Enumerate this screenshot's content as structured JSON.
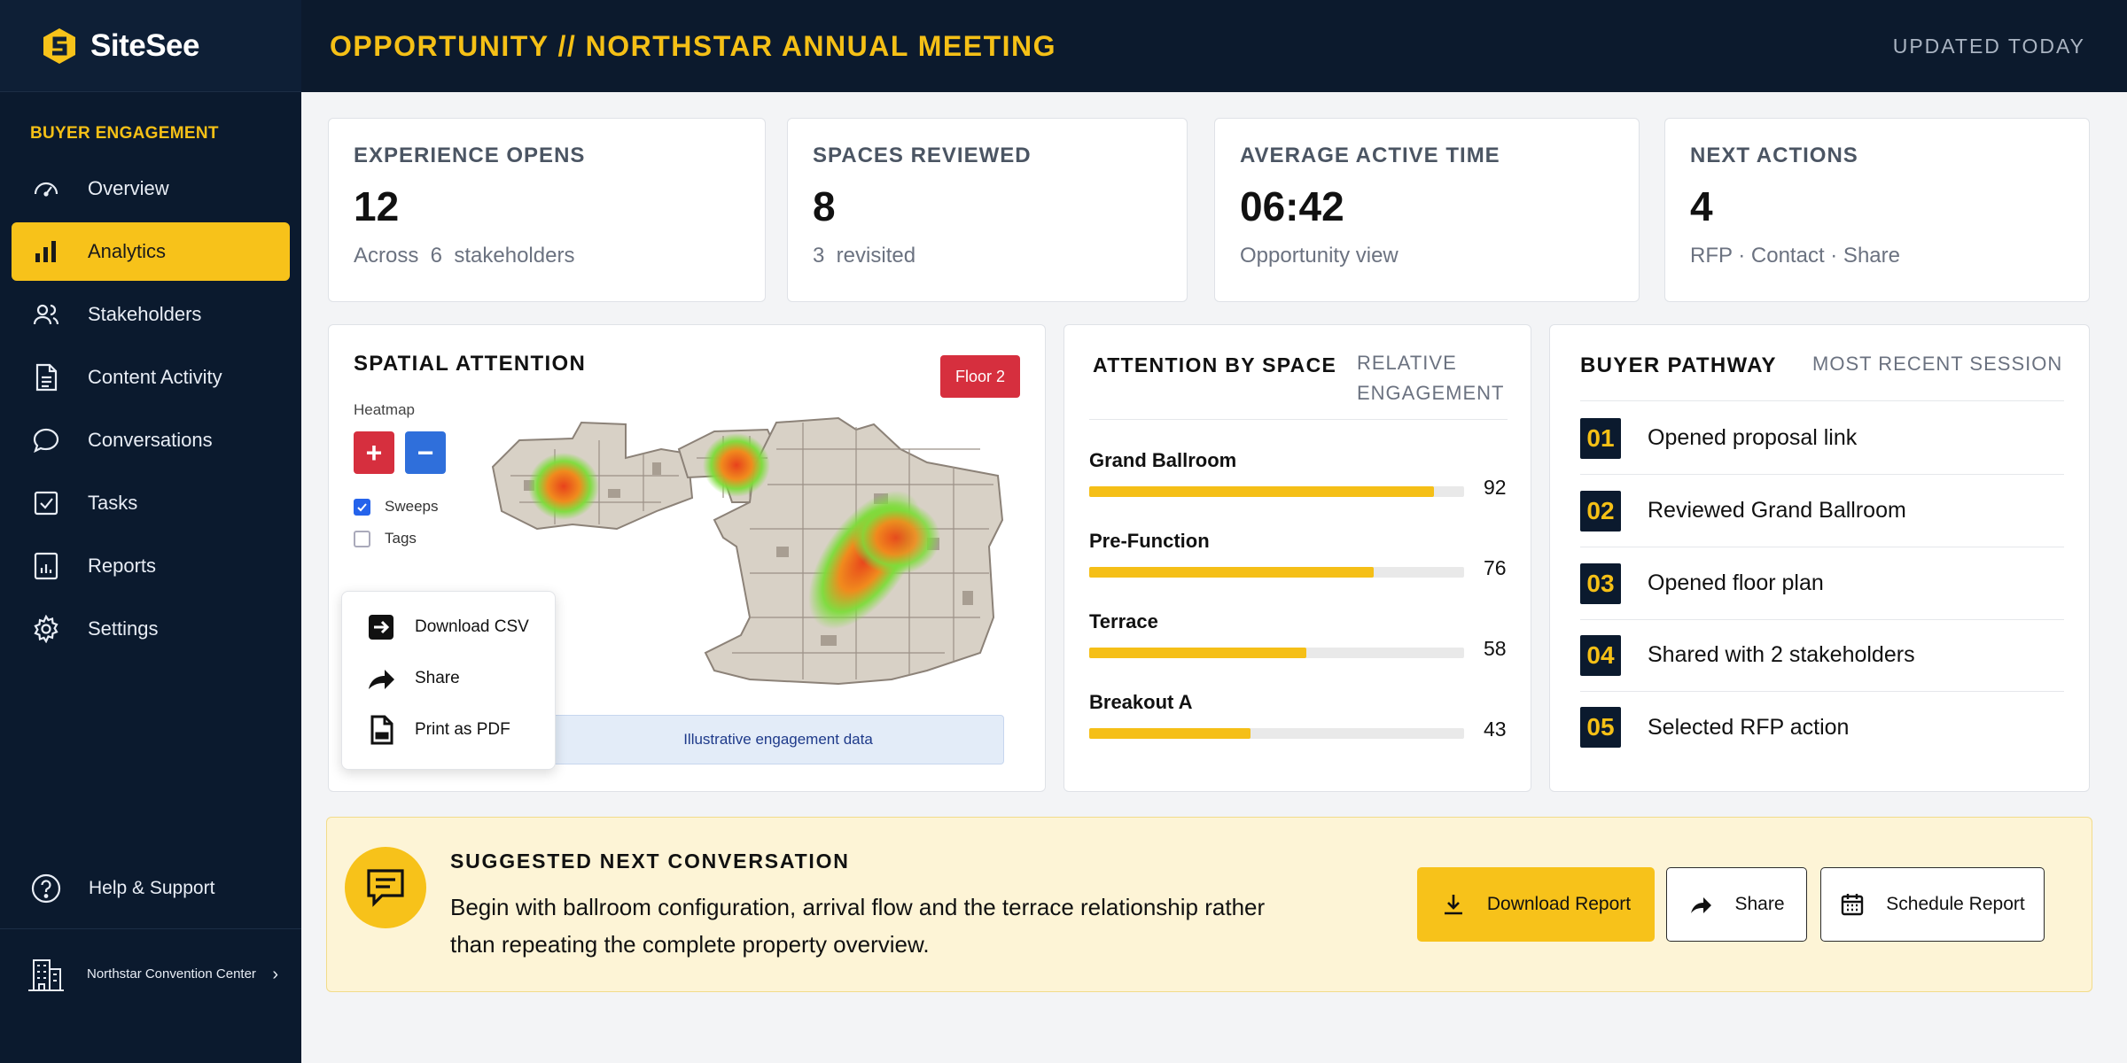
{
  "app": {
    "name": "SiteSee"
  },
  "sidebar": {
    "section_label": "BUYER ENGAGEMENT",
    "items": [
      {
        "label": "Overview",
        "icon": "gauge-icon"
      },
      {
        "label": "Analytics",
        "icon": "bar-chart-icon",
        "active": true
      },
      {
        "label": "Stakeholders",
        "icon": "users-icon"
      },
      {
        "label": "Content Activity",
        "icon": "document-icon"
      },
      {
        "label": "Conversations",
        "icon": "chat-icon"
      },
      {
        "label": "Tasks",
        "icon": "checkbox-icon"
      },
      {
        "label": "Reports",
        "icon": "report-icon"
      },
      {
        "label": "Settings",
        "icon": "gear-icon"
      }
    ],
    "help_label": "Help & Support",
    "venue_label": "Northstar Convention Center"
  },
  "header": {
    "title": "OPPORTUNITY // NORTHSTAR ANNUAL MEETING",
    "updated": "UPDATED TODAY"
  },
  "stats": [
    {
      "label": "EXPERIENCE OPENS",
      "value": "12",
      "sub": "Across  6  stakeholders"
    },
    {
      "label": "SPACES REVIEWED",
      "value": "8",
      "sub": "3  revisited"
    },
    {
      "label": "AVERAGE ACTIVE TIME",
      "value": "06:42",
      "sub": "Opportunity view"
    },
    {
      "label": "NEXT ACTIONS",
      "value": "4",
      "sub": "RFP · Contact · Share"
    }
  ],
  "spatial": {
    "title": "SPATIAL ATTENTION",
    "floor": "Floor 2",
    "heatmap_label": "Heatmap",
    "zoom_in": "+",
    "zoom_out": "−",
    "toggles": [
      {
        "label": "Sweeps",
        "checked": true
      },
      {
        "label": "Tags",
        "checked": false
      }
    ],
    "menu": [
      {
        "label": "Download CSV",
        "icon": "download-icon"
      },
      {
        "label": "Share",
        "icon": "share-icon"
      },
      {
        "label": "Print as PDF",
        "icon": "pdf-icon"
      }
    ],
    "note": "Illustrative engagement data"
  },
  "attention": {
    "title": "ATTENTION BY SPACE",
    "subtitle_line1": "RELATIVE",
    "subtitle_line2": "ENGAGEMENT",
    "spaces": [
      {
        "name": "Grand Ballroom",
        "value": 92
      },
      {
        "name": "Pre-Function",
        "value": 76
      },
      {
        "name": "Terrace",
        "value": 58
      },
      {
        "name": "Breakout A",
        "value": 43
      }
    ],
    "max": 100,
    "bar_color": "#f5bf17"
  },
  "pathway": {
    "title": "BUYER PATHWAY",
    "subtitle": "MOST RECENT SESSION",
    "steps": [
      {
        "num": "01",
        "text": "Opened proposal link"
      },
      {
        "num": "02",
        "text": "Reviewed Grand Ballroom"
      },
      {
        "num": "03",
        "text": "Opened floor plan"
      },
      {
        "num": "04",
        "text": "Shared with 2 stakeholders"
      },
      {
        "num": "05",
        "text": "Selected RFP action"
      }
    ]
  },
  "suggestion": {
    "title": "SUGGESTED NEXT CONVERSATION",
    "body": "Begin with ballroom configuration, arrival flow and the terrace relationship rather than repeating the complete property overview.",
    "download_label": "Download Report",
    "share_label": "Share",
    "schedule_label": "Schedule Report"
  },
  "colors": {
    "accent": "#f7c21a",
    "navy": "#0b1a2e",
    "danger": "#d62f3e",
    "primary": "#2563eb"
  }
}
